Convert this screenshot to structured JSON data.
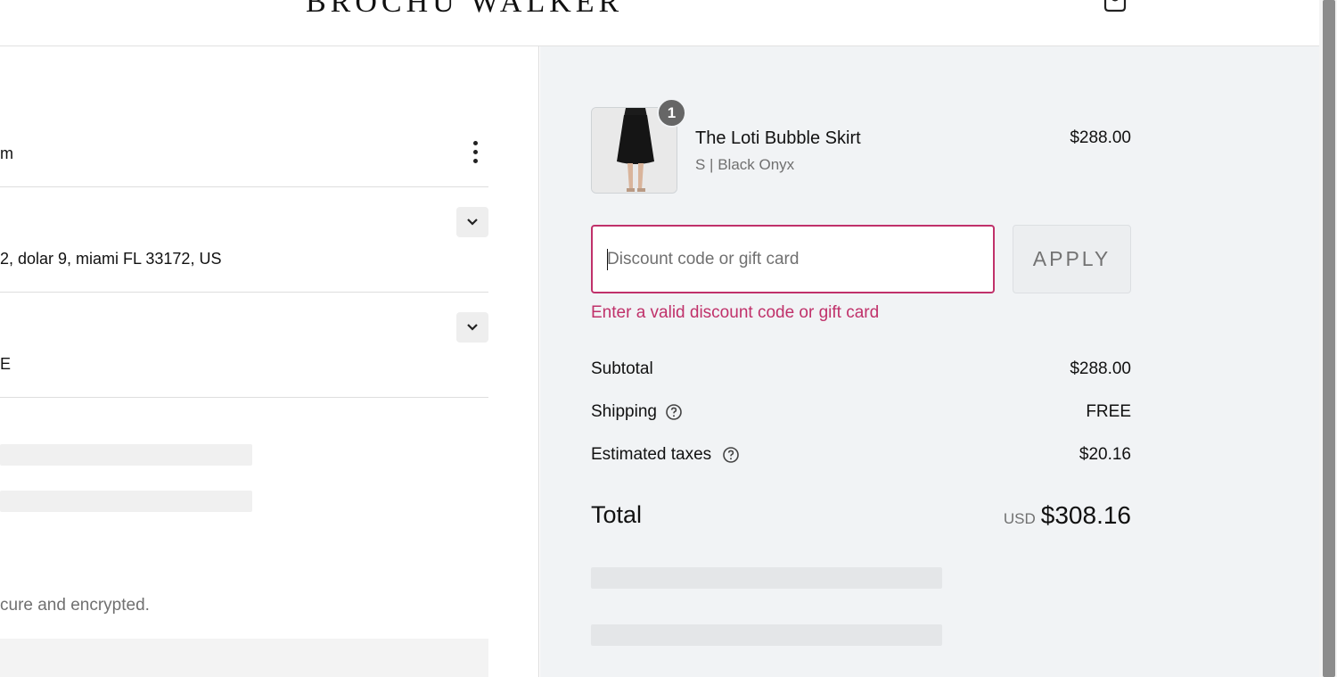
{
  "header": {
    "logo": "BROCHU WALKER",
    "cart_icon": "shopping-bag-icon"
  },
  "left": {
    "contact_fragment": "m",
    "ship_to_fragment": "2, dolar 9, miami FL 33172, US",
    "method_fragment": "E",
    "secure_fragment": "cure and encrypted."
  },
  "order": {
    "quantity": "1",
    "product_name": "The Loti Bubble Skirt",
    "product_variant": "S | Black Onyx",
    "product_price": "$288.00"
  },
  "discount": {
    "placeholder": "Discount code or gift card",
    "apply_label": "APPLY",
    "error": "Enter a valid discount code or gift card"
  },
  "summary": {
    "subtotal_label": "Subtotal",
    "subtotal_value": "$288.00",
    "shipping_label": "Shipping",
    "shipping_value": "FREE",
    "taxes_label": "Estimated taxes",
    "taxes_value": "$20.16",
    "total_label": "Total",
    "currency": "USD",
    "total_value": "$308.16"
  },
  "colors": {
    "accent_error": "#c0316a",
    "summary_bg": "#f1f3f5"
  }
}
